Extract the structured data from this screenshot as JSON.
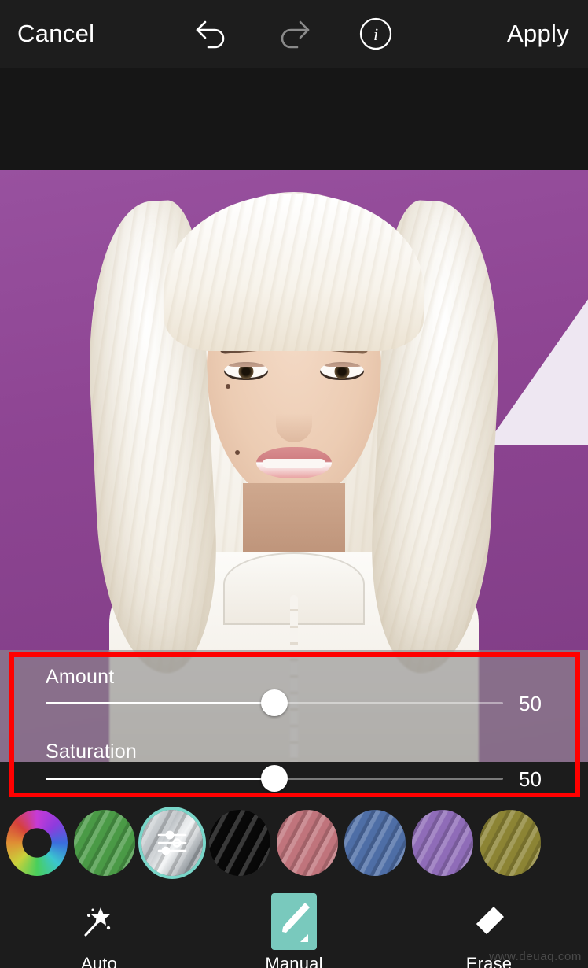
{
  "app": {
    "accent_teal": "#79c9bd",
    "panel_dark": "#1c1c1c",
    "annotation_color": "#ff0000"
  },
  "topbar": {
    "cancel_label": "Cancel",
    "apply_label": "Apply",
    "undo_icon": "undo-arrow-icon",
    "redo_icon": "redo-arrow-icon",
    "info_icon": "info-circle-icon",
    "undo_state": "enabled",
    "redo_state": "disabled"
  },
  "sliders": [
    {
      "label": "Amount",
      "value": "50",
      "percent": 50
    },
    {
      "label": "Saturation",
      "value": "50",
      "percent": 50
    }
  ],
  "swatches": [
    {
      "name": "color-wheel",
      "label": "Color Wheel",
      "color": "#c63bd6",
      "selected": false,
      "type": "wheel"
    },
    {
      "name": "green",
      "label": "Green",
      "color": "#4a9a46",
      "selected": false,
      "type": "hair"
    },
    {
      "name": "silver-custom",
      "label": "Custom Silver",
      "color": "#c9cdd0",
      "selected": true,
      "type": "custom"
    },
    {
      "name": "black",
      "label": "Black",
      "color": "#080808",
      "selected": false,
      "type": "hair"
    },
    {
      "name": "pink",
      "label": "Pink",
      "color": "#c0747c",
      "selected": false,
      "type": "hair"
    },
    {
      "name": "blue",
      "label": "Blue",
      "color": "#4e6ea6",
      "selected": false,
      "type": "hair"
    },
    {
      "name": "purple",
      "label": "Purple",
      "color": "#8f6cb8",
      "selected": false,
      "type": "hair"
    },
    {
      "name": "olive",
      "label": "Olive",
      "color": "#8c8434",
      "selected": false,
      "type": "hair"
    }
  ],
  "tools": [
    {
      "name": "auto",
      "label": "Auto",
      "icon": "magic-wand-icon",
      "active": false
    },
    {
      "name": "manual",
      "label": "Manual",
      "icon": "paintbrush-icon",
      "active": true
    },
    {
      "name": "erase",
      "label": "Erase",
      "icon": "eraser-icon",
      "active": false
    }
  ],
  "watermark": {
    "text": "www.deuaq.com"
  }
}
